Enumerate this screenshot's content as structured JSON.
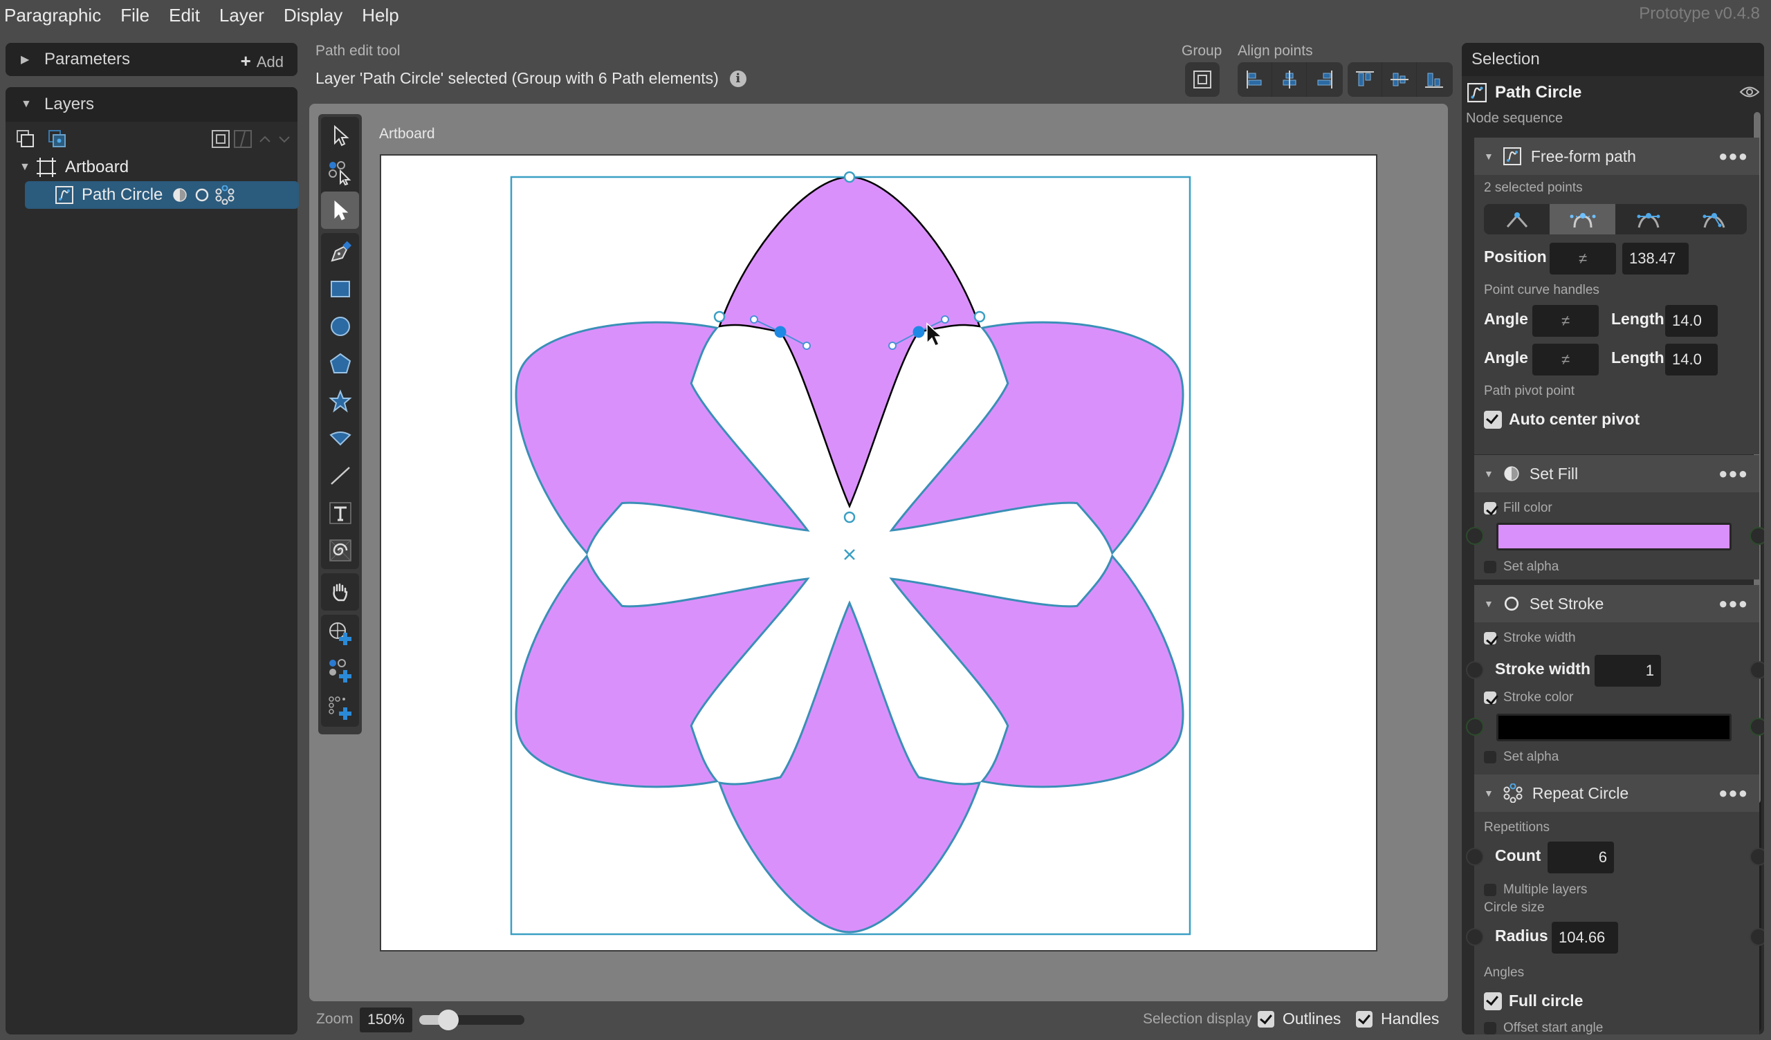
{
  "app": {
    "menu": [
      "Paragraphic",
      "File",
      "Edit",
      "Layer",
      "Display",
      "Help"
    ],
    "version": "Prototype v0.4.8"
  },
  "left": {
    "parameters": {
      "title": "Parameters",
      "add_label": "Add"
    },
    "layers": {
      "title": "Layers",
      "items": [
        {
          "name": "Artboard",
          "icon": "artboard-icon",
          "expanded": true
        },
        {
          "name": "Path Circle",
          "icon": "path-icon",
          "selected": true,
          "badges": [
            "fill-icon",
            "stroke-icon",
            "repeat-circle-icon"
          ]
        }
      ]
    }
  },
  "canvas": {
    "tool_hint": "Path edit tool",
    "selection_info": "Layer 'Path Circle' selected (Group with 6 Path elements)",
    "group_label": "Group",
    "align_label": "Align points",
    "artboard_label": "Artboard",
    "tools": [
      "select-icon",
      "multi-select-icon",
      "direct-select-icon",
      "pen-icon",
      "rectangle-icon",
      "ellipse-icon",
      "polygon-icon",
      "star-icon",
      "wedge-icon",
      "line-icon",
      "text-icon",
      "image-icon",
      "hand-icon",
      "add-transform-icon",
      "add-node-icon",
      "add-grid-icon"
    ],
    "active_tool": "direct-select-icon",
    "artwork": {
      "fill": "#DA90FB",
      "stroke": "#000000",
      "outline_color": "#3A8FB7",
      "handle_color": "#1E88E5",
      "petals": 6
    }
  },
  "bottom": {
    "zoom_label": "Zoom",
    "zoom_value": "150%",
    "zoom_slider_fraction": 0.18,
    "selection_display_label": "Selection display",
    "outlines_label": "Outlines",
    "outlines_checked": true,
    "handles_label": "Handles",
    "handles_checked": true
  },
  "selection": {
    "title": "Selection",
    "layer_name": "Path Circle",
    "node_sequence_label": "Node sequence",
    "freeform": {
      "title": "Free-form path",
      "selected_points": "2 selected points",
      "curve_modes": [
        "corner",
        "smooth-symmetric",
        "smooth-aligned",
        "free"
      ],
      "active_mode": 1,
      "position_label": "Position",
      "position_x": "≠",
      "position_y": "138.47",
      "handles_label": "Point curve handles",
      "angle_label": "Angle",
      "length_label": "Length",
      "angle1": "≠",
      "length1": "14.0",
      "angle2": "≠",
      "length2": "14.0",
      "pivot_label": "Path pivot point",
      "auto_center_label": "Auto center pivot",
      "auto_center_checked": true
    },
    "fill": {
      "title": "Set Fill",
      "fill_color_label": "Fill color",
      "fill_color_checked": true,
      "color": "#DA90FB",
      "set_alpha_label": "Set alpha",
      "set_alpha_checked": false
    },
    "stroke": {
      "title": "Set Stroke",
      "stroke_width_check_label": "Stroke width",
      "stroke_width_checked": true,
      "stroke_width_label": "Stroke width",
      "stroke_width_value": "1",
      "stroke_color_label": "Stroke color",
      "stroke_color_checked": true,
      "color": "#000000",
      "set_alpha_label": "Set alpha",
      "set_alpha_checked": false
    },
    "repeat": {
      "title": "Repeat Circle",
      "repetitions_label": "Repetitions",
      "count_label": "Count",
      "count_value": "6",
      "multiple_layers_label": "Multiple layers",
      "multiple_layers_checked": false,
      "circle_size_label": "Circle size",
      "radius_label": "Radius",
      "radius_value": "104.66",
      "angles_label": "Angles",
      "full_circle_label": "Full circle",
      "full_circle_checked": true,
      "offset_label": "Offset start angle",
      "offset_checked": false
    }
  }
}
